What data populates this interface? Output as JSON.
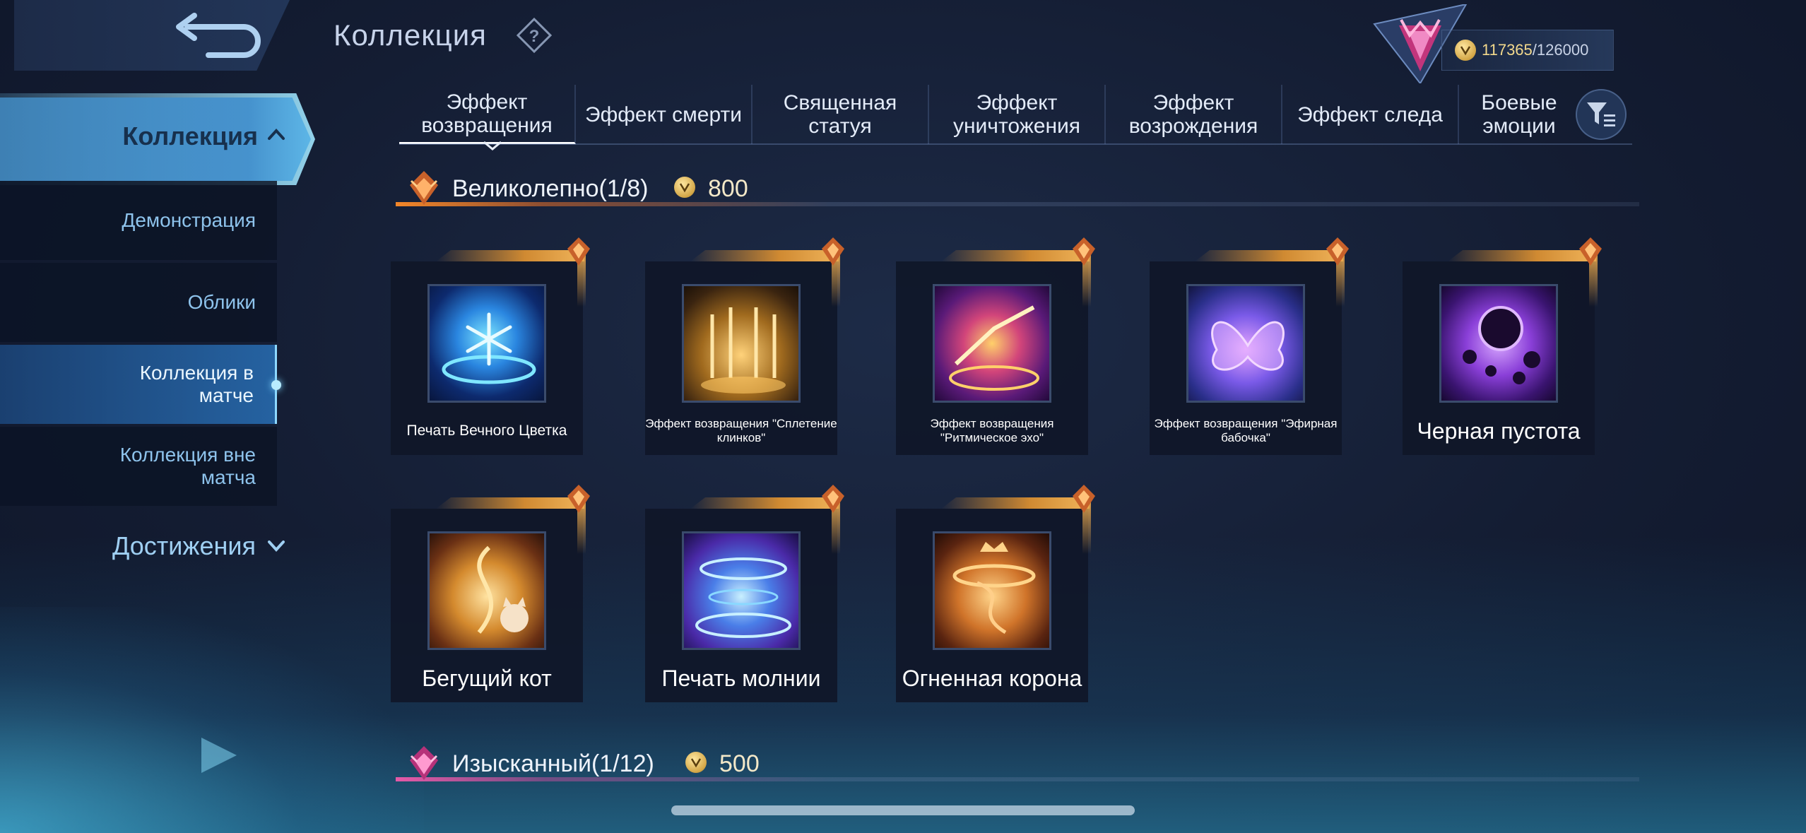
{
  "header": {
    "title": "Коллекция",
    "currency": {
      "current": "117365",
      "separator": "/",
      "max": "126000"
    }
  },
  "sidebar": {
    "main": "Коллекция",
    "items": [
      {
        "label": "Демонстрация"
      },
      {
        "label": "Облики"
      },
      {
        "label": "Коллекция в матче"
      },
      {
        "label": "Коллекция вне матча"
      }
    ],
    "achievements": "Достижения"
  },
  "tabs": [
    {
      "label": "Эффект возвращения"
    },
    {
      "label": "Эффект смерти"
    },
    {
      "label": "Священная статуя"
    },
    {
      "label": "Эффект уничтожения"
    },
    {
      "label": "Эффект возрождения"
    },
    {
      "label": "Эффект следа"
    },
    {
      "label": "Боевые эмоции"
    }
  ],
  "sections": [
    {
      "label": "Великолепно(1/8)",
      "price": "800",
      "items": [
        {
          "name": "Печать Вечного Цветка"
        },
        {
          "name": "Эффект возвращения \"Сплетение клинков\""
        },
        {
          "name": "Эффект возвращения \"Ритмическое эхо\""
        },
        {
          "name": "Эффект возвращения \"Эфирная бабочка\""
        },
        {
          "name": "Черная пустота"
        },
        {
          "name": "Бегущий кот"
        },
        {
          "name": "Печать молнии"
        },
        {
          "name": "Огненная корона"
        }
      ]
    },
    {
      "label": "Изысканный(1/12)",
      "price": "500"
    }
  ],
  "colors": {
    "accent_orange": "#d08a32",
    "accent_pink": "#e0509a",
    "active_blue": "#5aa8e0"
  },
  "icons": {
    "back": "back-arrow-icon",
    "help": "help-question-icon",
    "rank": "rank-emblem-icon",
    "coin": "battle-point-coin-icon",
    "filter": "filter-funnel-icon"
  }
}
